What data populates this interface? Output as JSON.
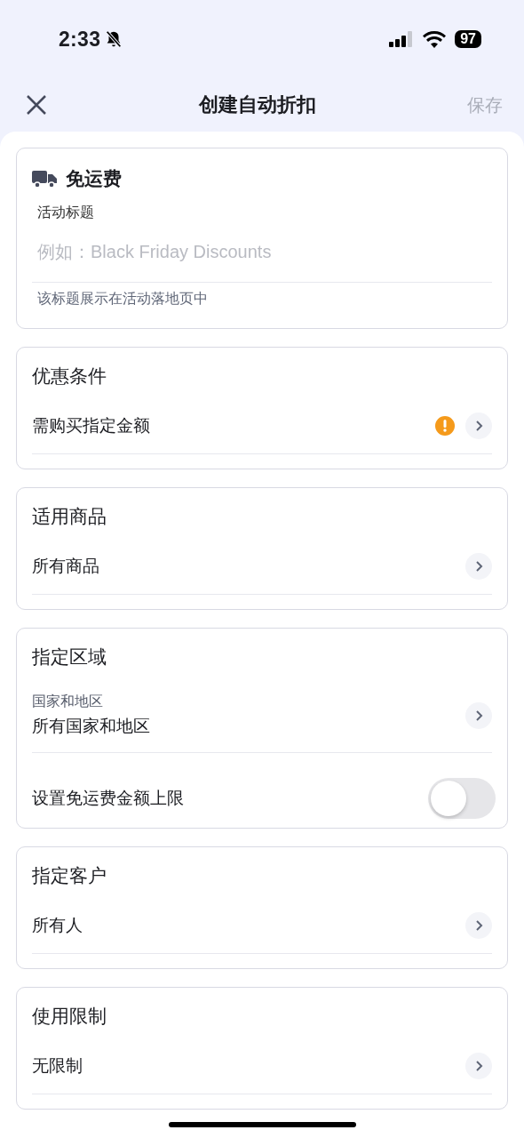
{
  "status_bar": {
    "time": "2:33",
    "battery": "97"
  },
  "nav": {
    "title": "创建自动折扣",
    "save": {
      "label": "保存",
      "disabled": true
    }
  },
  "title_card": {
    "heading": "免运费",
    "field_label": "活动标题",
    "placeholder": "例如：Black Friday Discounts",
    "hint": "该标题展示在活动落地页中"
  },
  "sections": [
    {
      "title": "优惠条件",
      "rows": [
        {
          "kind": "link",
          "label": "需购买指定金额",
          "warning": true
        }
      ]
    },
    {
      "title": "适用商品",
      "rows": [
        {
          "kind": "link",
          "label": "所有商品",
          "warning": false
        }
      ]
    },
    {
      "title": "指定区域",
      "rows": [
        {
          "kind": "link",
          "sublabel": "国家和地区",
          "label": "所有国家和地区",
          "warning": false
        },
        {
          "kind": "toggle",
          "label": "设置免运费金额上限",
          "on": false
        }
      ]
    },
    {
      "title": "指定客户",
      "rows": [
        {
          "kind": "link",
          "label": "所有人",
          "warning": false
        }
      ]
    },
    {
      "title": "使用限制",
      "rows": [
        {
          "kind": "link",
          "label": "无限制",
          "warning": false
        }
      ]
    }
  ]
}
